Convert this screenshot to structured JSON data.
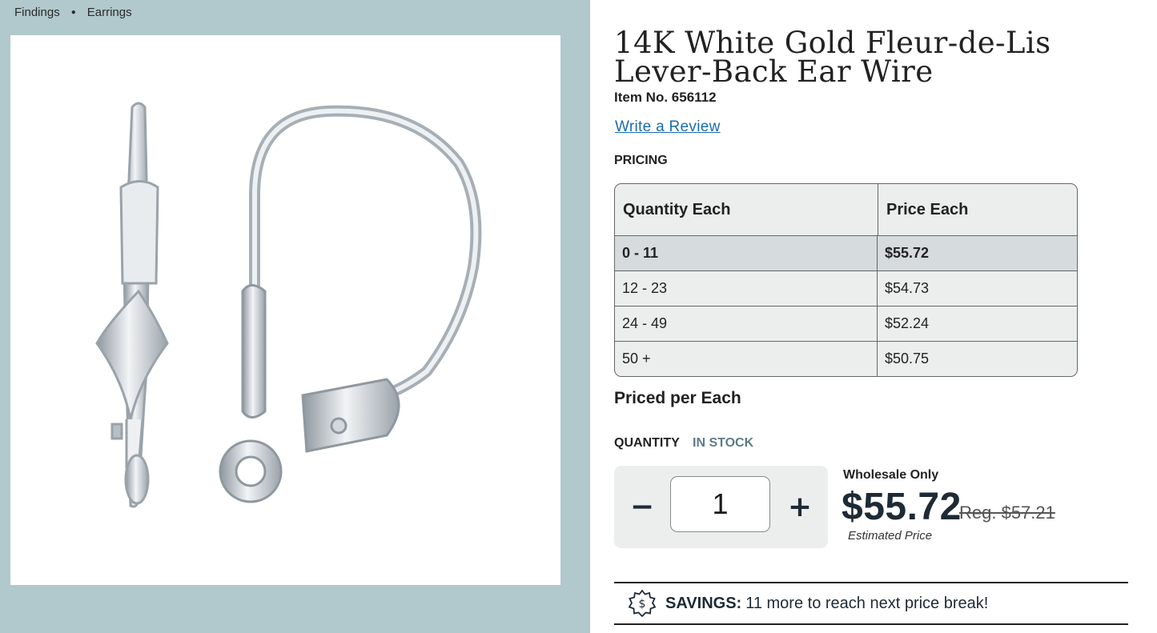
{
  "breadcrumb": {
    "items": [
      "Findings",
      "Earrings"
    ]
  },
  "product": {
    "title": "14K White Gold Fleur-de-Lis Lever-Back Ear Wire",
    "item_no": "Item No. 656112",
    "review_link": "Write a Review"
  },
  "pricing": {
    "label": "PRICING",
    "headers": [
      "Quantity Each",
      "Price Each"
    ],
    "rows": [
      {
        "qty": "0 - 11",
        "price": "$55.72"
      },
      {
        "qty": "12 - 23",
        "price": "$54.73"
      },
      {
        "qty": "24 - 49",
        "price": "$52.24"
      },
      {
        "qty": "50 +",
        "price": "$50.75"
      }
    ],
    "priced_per": "Priced per Each"
  },
  "quantity": {
    "label": "QUANTITY",
    "stock": "IN STOCK",
    "minus": "−",
    "plus": "+",
    "value": "1"
  },
  "price_summary": {
    "wholesale": "Wholesale Only",
    "price": "$55.72",
    "regular": "Reg. $57.21",
    "estimated": "Estimated Price"
  },
  "savings": {
    "icon": "savings-badge-icon",
    "label": "SAVINGS:",
    "text": "11 more to reach next price break!"
  },
  "colors": {
    "left_bg": "#b1c8cc",
    "link": "#1a6db0",
    "stock": "#5f7b8a",
    "price": "#1e2a36"
  }
}
